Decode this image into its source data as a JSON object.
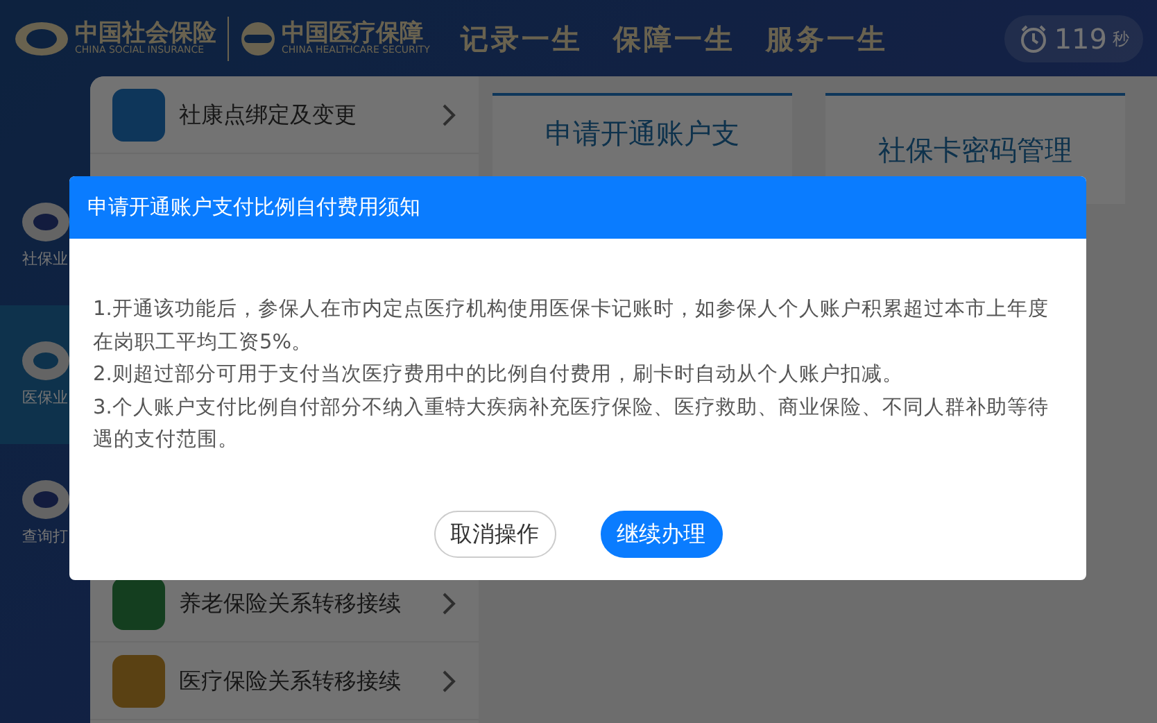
{
  "header": {
    "logo_social": {
      "name": "中国社会保险",
      "subtitle": "CHINA SOCIAL INSURANCE"
    },
    "logo_health": {
      "name": "中国医疗保障",
      "subtitle": "CHINA HEALTHCARE SECURITY"
    },
    "slogans": [
      "记录一生",
      "保障一生",
      "服务一生"
    ],
    "timer": {
      "value": "119",
      "unit": "秒"
    }
  },
  "sidebar": {
    "items": [
      {
        "label": "社保业",
        "selected": false
      },
      {
        "label": "医保业",
        "selected": true
      },
      {
        "label": "查询打",
        "selected": false
      }
    ]
  },
  "service_list_top": [
    {
      "label": "社康点绑定及变更"
    }
  ],
  "service_list_bottom": [
    {
      "label": "养老保险关系转移接续"
    },
    {
      "label": "医疗保险关系转移接续"
    }
  ],
  "cards": [
    {
      "title": "申请开通账户支"
    },
    {
      "title": "社保卡密码管理"
    }
  ],
  "dialog": {
    "title": "申请开通账户支付比例自付费用须知",
    "paragraphs": [
      "1.开通该功能后，参保人在市内定点医疗机构使用医保卡记账时，如参保人个人账户积累超过本市上年度在岗职工平均工资5%。",
      "2.则超过部分可用于支付当次医疗费用中的比例自付费用，刷卡时自动从个人账户扣减。",
      "3.个人账户支付比例自付部分不纳入重特大疾病补充医疗保险、医疗救助、商业保险、不同人群补助等待遇的支付范围。"
    ],
    "buttons": [
      {
        "label": "取消操作",
        "kind": "secondary"
      },
      {
        "label": "继续办理",
        "kind": "primary"
      }
    ]
  }
}
